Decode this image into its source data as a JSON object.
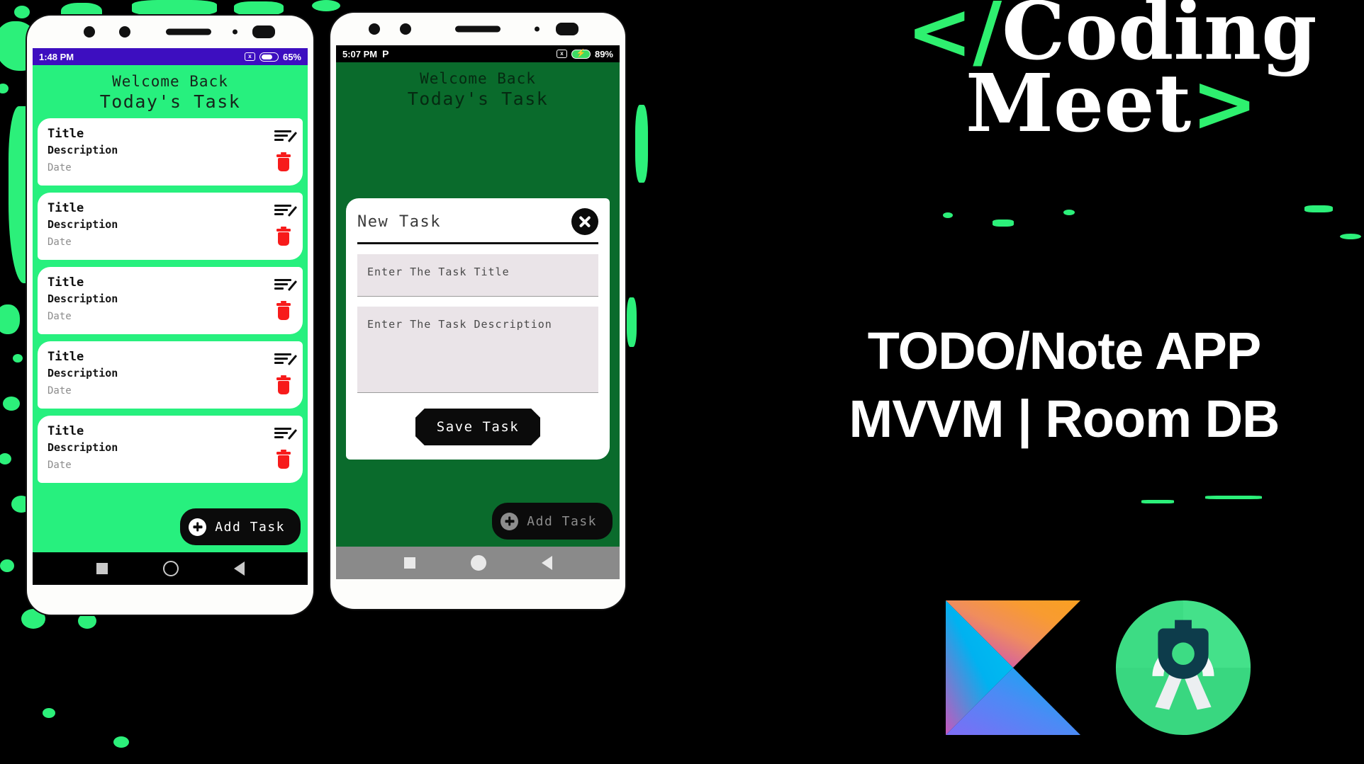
{
  "brand": {
    "logo_open_bracket": "</",
    "logo_word1": "Coding",
    "logo_word2": "Meet",
    "logo_close_bracket": ">",
    "headline_line1": "TODO/Note APP",
    "headline_line2": "MVVM | Room DB",
    "accent_green": "#2ef06f",
    "kotlin_logo_name": "kotlin-logo",
    "android_studio_logo_name": "android-studio-logo"
  },
  "phone_left": {
    "statusbar": {
      "time": "1:48 PM",
      "battery_percent": "65%",
      "mute_icon": "x",
      "background": "#3d0ec0"
    },
    "header": {
      "line1": "Welcome Back",
      "line2": "Today's Task"
    },
    "background": "#27f07e",
    "tasks": [
      {
        "title": "Title",
        "description": "Description",
        "date": "Date"
      },
      {
        "title": "Title",
        "description": "Description",
        "date": "Date"
      },
      {
        "title": "Title",
        "description": "Description",
        "date": "Date"
      },
      {
        "title": "Title",
        "description": "Description",
        "date": "Date"
      },
      {
        "title": "Title",
        "description": "Description",
        "date": "Date"
      }
    ],
    "fab_label": "Add Task",
    "navbar": {
      "recents": "square",
      "home": "circle",
      "back": "triangle"
    }
  },
  "phone_right": {
    "statusbar": {
      "time": "5:07 PM",
      "p_icon": "P",
      "battery_percent": "89%",
      "mute_icon": "x",
      "background": "#000000"
    },
    "header": {
      "line1": "Welcome Back",
      "line2": "Today's Task"
    },
    "background": "#0a6b2c",
    "dialog": {
      "title": "New Task",
      "close_icon": "close-icon",
      "title_placeholder": "Enter The Task Title",
      "description_placeholder": "Enter The Task Description",
      "save_label": "Save Task"
    },
    "fab_label": "Add Task",
    "navbar": {
      "recents": "square",
      "home": "circle",
      "back": "triangle"
    }
  }
}
